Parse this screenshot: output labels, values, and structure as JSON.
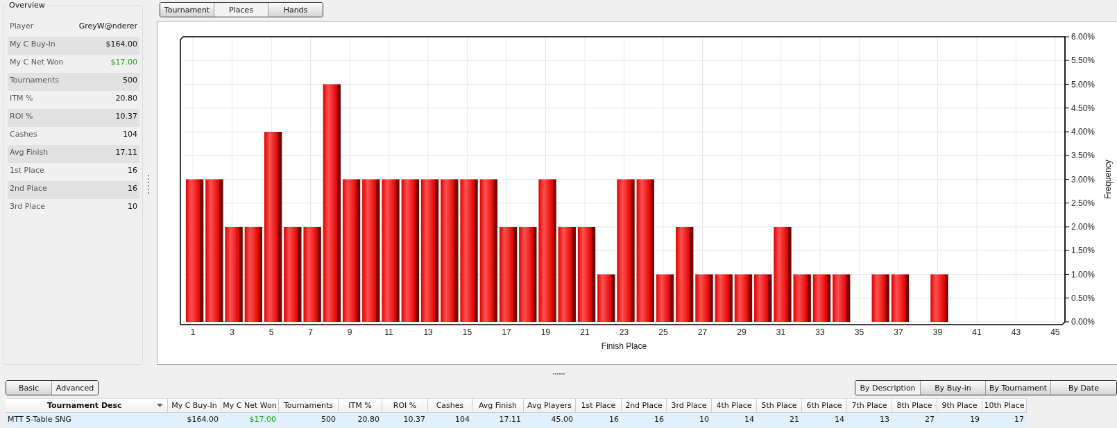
{
  "overview": {
    "title": "Overview",
    "rows": [
      {
        "label": "Player",
        "value": "GreyW@nderer",
        "positive": false
      },
      {
        "label": "My C Buy-In",
        "value": "$164.00",
        "positive": false
      },
      {
        "label": "My C Net Won",
        "value": "$17.00",
        "positive": true
      },
      {
        "label": "Tournaments",
        "value": "500",
        "positive": false
      },
      {
        "label": "ITM %",
        "value": "20.80",
        "positive": false
      },
      {
        "label": "ROI %",
        "value": "10.37",
        "positive": false
      },
      {
        "label": "Cashes",
        "value": "104",
        "positive": false
      },
      {
        "label": "Avg Finish",
        "value": "17.11",
        "positive": false
      },
      {
        "label": "1st Place",
        "value": "16",
        "positive": false
      },
      {
        "label": "2nd Place",
        "value": "16",
        "positive": false
      },
      {
        "label": "3rd Place",
        "value": "10",
        "positive": false
      }
    ]
  },
  "view_tabs": [
    {
      "label": "Tournament",
      "selected": false
    },
    {
      "label": "Places",
      "selected": true
    },
    {
      "label": "Hands",
      "selected": false
    }
  ],
  "chart": {
    "chart_data": {
      "type": "bar",
      "xlabel": "Finish Place",
      "ylabel": "Frequency",
      "x": [
        1,
        2,
        3,
        4,
        5,
        6,
        7,
        8,
        9,
        10,
        11,
        12,
        13,
        14,
        15,
        16,
        17,
        18,
        19,
        20,
        21,
        22,
        23,
        24,
        25,
        26,
        27,
        28,
        29,
        30,
        31,
        32,
        33,
        34,
        35,
        36,
        37,
        38,
        39,
        40,
        41,
        42,
        43,
        44,
        45
      ],
      "grid": true,
      "xlim": [
        0.5,
        45.5
      ],
      "series": [
        {
          "color": "#e00000",
          "values": [
            3,
            3,
            2,
            2,
            4,
            2,
            2,
            5,
            3,
            3,
            3,
            3,
            3,
            3,
            3,
            3,
            2,
            2,
            3,
            2,
            2,
            1,
            3,
            3,
            1,
            2,
            1,
            1,
            1,
            1,
            2,
            1,
            1,
            1,
            0,
            1,
            1,
            0,
            1,
            0,
            0,
            0,
            0,
            0,
            0
          ]
        }
      ],
      "ylim": [
        0,
        6
      ],
      "xticks": [
        1,
        3,
        5,
        7,
        9,
        11,
        13,
        15,
        17,
        19,
        21,
        23,
        25,
        27,
        29,
        31,
        33,
        35,
        37,
        39,
        41,
        43,
        45
      ],
      "yticks": [
        {
          "value": 0,
          "label": "0.00%"
        },
        {
          "value": 0.5,
          "label": "0.50%"
        },
        {
          "value": 1,
          "label": "1.00%"
        },
        {
          "value": 1.5,
          "label": "1.50%"
        },
        {
          "value": 2,
          "label": "2.00%"
        },
        {
          "value": 2.5,
          "label": "2.50%"
        },
        {
          "value": 3,
          "label": "3.00%"
        },
        {
          "value": 3.5,
          "label": "3.50%"
        },
        {
          "value": 4,
          "label": "4.00%"
        },
        {
          "value": 4.5,
          "label": "4.50%"
        },
        {
          "value": 5,
          "label": "5.00%"
        },
        {
          "value": 5.5,
          "label": "5.50%"
        },
        {
          "value": 6,
          "label": "6.00%"
        }
      ]
    }
  },
  "mode_tabs": [
    {
      "label": "Basic",
      "selected": false
    },
    {
      "label": "Advanced",
      "selected": true
    }
  ],
  "group_tabs": [
    {
      "label": "By Description",
      "selected": true
    },
    {
      "label": "By Buy-in",
      "selected": false
    },
    {
      "label": "By Tournament",
      "selected": false
    },
    {
      "label": "By Date",
      "selected": false
    }
  ],
  "table": {
    "columns": [
      "Tournament Desc",
      "My C Buy-In",
      "My C Net Won",
      "Tournaments",
      "ITM %",
      "ROI %",
      "Cashes",
      "Avg Finish",
      "Avg Players",
      "1st Place",
      "2nd Place",
      "3rd Place",
      "4th Place",
      "5th Place",
      "6th Place",
      "7th Place",
      "8th Place",
      "9th Place",
      "10th Place"
    ],
    "rows": [
      {
        "cells": [
          {
            "text": "MTT 5-Table SNG",
            "positive": false
          },
          {
            "text": "$164.00",
            "positive": false
          },
          {
            "text": "$17.00",
            "positive": true
          },
          {
            "text": "500",
            "positive": false
          },
          {
            "text": "20.80",
            "positive": false
          },
          {
            "text": "10.37",
            "positive": false
          },
          {
            "text": "104",
            "positive": false
          },
          {
            "text": "17.11",
            "positive": false
          },
          {
            "text": "45.00",
            "positive": false
          },
          {
            "text": "16",
            "positive": false
          },
          {
            "text": "16",
            "positive": false
          },
          {
            "text": "10",
            "positive": false
          },
          {
            "text": "14",
            "positive": false
          },
          {
            "text": "21",
            "positive": false
          },
          {
            "text": "14",
            "positive": false
          },
          {
            "text": "13",
            "positive": false
          },
          {
            "text": "27",
            "positive": false
          },
          {
            "text": "19",
            "positive": false
          },
          {
            "text": "17",
            "positive": false
          }
        ]
      }
    ]
  }
}
